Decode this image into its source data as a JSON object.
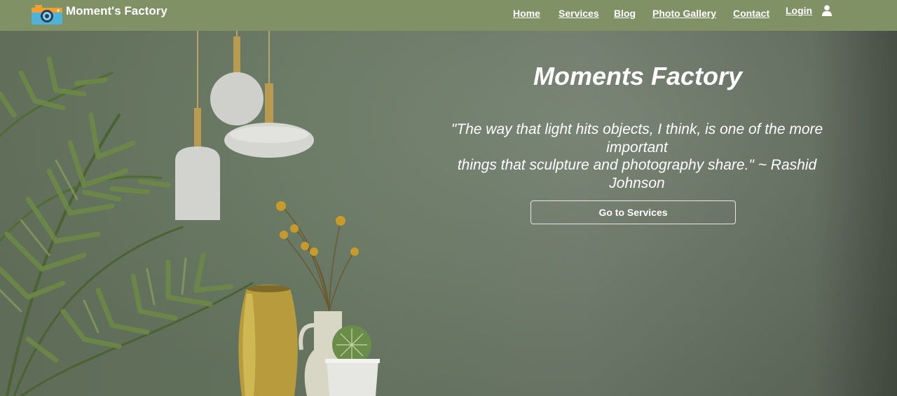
{
  "navbar": {
    "brand_name": "Moment's Factory",
    "brand_logo_icon": "camera-icon",
    "links": [
      {
        "id": "home",
        "label": "Home"
      },
      {
        "id": "services",
        "label": "Services"
      },
      {
        "id": "blog",
        "label": "Blog"
      },
      {
        "id": "photo_gallery",
        "label": "Photo Gallery"
      },
      {
        "id": "contact",
        "label": "Contact"
      }
    ],
    "login_label": "Login",
    "user_icon": "user-icon",
    "background_color": "#7f9165"
  },
  "hero": {
    "title": "Moments Factory",
    "quote_line1": "\"The way that light hits objects, I think, is one of the more important",
    "quote_line2": "things that sculpture and photography share.\" ~ Rashid Johnson",
    "button_label": "Go to Services",
    "background_color": "#6f8069"
  }
}
